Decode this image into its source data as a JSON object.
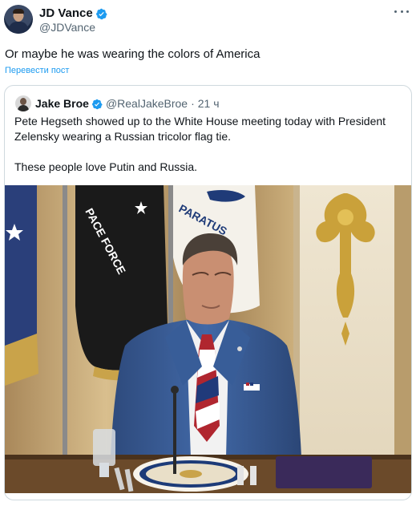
{
  "author": {
    "display_name": "JD Vance",
    "handle": "@JDVance",
    "verified": true
  },
  "tweet": {
    "text": "Or maybe he was wearing the colors of America",
    "translate_label": "Перевести пост",
    "more_icon": "more-horizontal-icon"
  },
  "quote": {
    "display_name": "Jake Broe",
    "handle": "@RealJakeBroe",
    "separator": "·",
    "time": "21 ч",
    "verified": true,
    "paragraphs": [
      "Pete Hegseth showed up to the White House meeting today with President Zelensky wearing a Russian tricolor flag tie.",
      "These people love Putin and Russia."
    ],
    "flag_text_1": "PACE FORCE",
    "flag_text_2": "PARATUS"
  },
  "colors": {
    "link": "#1d9bf0",
    "verified": "#1d9bf0",
    "secondary_text": "#536471",
    "border": "#cfd9de"
  }
}
